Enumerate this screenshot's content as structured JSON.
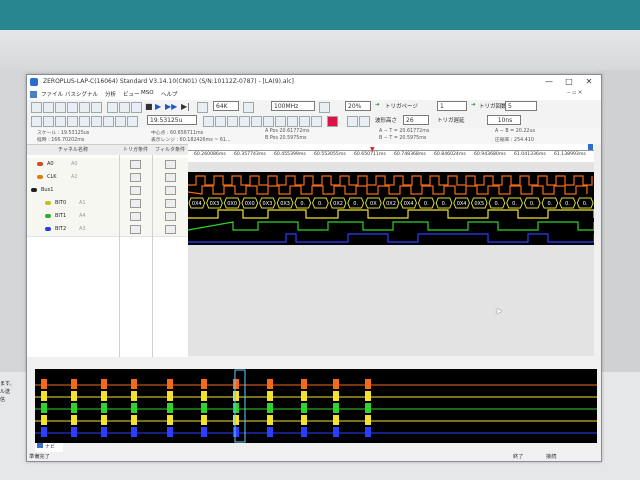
{
  "window": {
    "title": "ZEROPLUS-LAP-C(16064) Standard V3.14.10(CN01) (S/N:10112Z-0787) - [LA(9).alc]",
    "controls": [
      "—",
      "□",
      "✕"
    ]
  },
  "menu": [
    "ファイル",
    "バスシグナル",
    "分析",
    "ビュー",
    "MSO",
    "ヘルプ"
  ],
  "toolbar": {
    "memory": "64K",
    "sample_rate": "100MHz",
    "trigger_position": "20%",
    "trigger_page_label": "トリガページ",
    "trigger_page": "1",
    "trigger_count_label": "トリガ回数",
    "trigger_count": "5",
    "time_per_div": "19.53125u",
    "waveform_height_label": "波形高さ",
    "waveform_height": "26",
    "trigger_delay_label": "トリガ遅延",
    "trigger_delay": "10ns"
  },
  "info": {
    "scale": "スケール : 19.53125us",
    "total_time": "経時 : 166.70202ms",
    "center": "中心点 : 60.656711ms",
    "display_range": "表示レンジ : 60.182426ms ~ 61...",
    "a_pos": "A Pos 20.61772ms",
    "b_pos": "B Pos 20.5975ms",
    "a_minus_t": "A − T = 20.61772ms",
    "b_minus_t": "B − T = 20.5975ms",
    "a_minus_b": "A − B = 20.22us",
    "compression": "圧縮率 : 254.410"
  },
  "channel_panel": {
    "headers": [
      "チャネル名称",
      "トリガ条件",
      "フィルタ条件"
    ],
    "rows": [
      {
        "name": "A0",
        "pin": "A0",
        "color": "#d84a1b"
      },
      {
        "name": "CLK",
        "pin": "A2",
        "color": "#e07b10"
      },
      {
        "name": "Bus1",
        "pin": "",
        "color": "#222222"
      },
      {
        "name": "BIT0",
        "pin": "A1",
        "color": "#c9c020"
      },
      {
        "name": "BIT1",
        "pin": "A4",
        "color": "#2fae2f"
      },
      {
        "name": "BIT2",
        "pin": "A3",
        "color": "#2a3fd8"
      }
    ]
  },
  "timestamps": [
    "60.260086ms",
    "60.357743ms",
    "60.455399ms",
    "60.553055ms",
    "60.650711ms",
    "60.748368ms",
    "60.846024ms",
    "60.943680ms",
    "61.041336ms",
    "61.138993ms"
  ],
  "bus_values": [
    "0X4",
    "0X3",
    "0X0",
    "0X0",
    "0X3",
    "0X3",
    "0.",
    "0.",
    "0X2",
    "0.",
    "0X",
    "0X2",
    "0X4",
    "0.",
    "0.",
    "0X4",
    "0X5",
    "0.",
    "0.",
    "0.",
    "0.",
    "0.",
    "0."
  ],
  "overview": {
    "tab": "ナビ"
  },
  "status": {
    "left": "準備完了",
    "end": "終了",
    "connected": "接続"
  },
  "background": {
    "lines": [
      "ます。",
      "ル送",
      "信"
    ]
  },
  "colors": {
    "orange": "#f26a1b",
    "yellow": "#f2e22e",
    "green": "#2fd22f",
    "blue": "#2a3fff",
    "bus": "#dcdc3a"
  }
}
